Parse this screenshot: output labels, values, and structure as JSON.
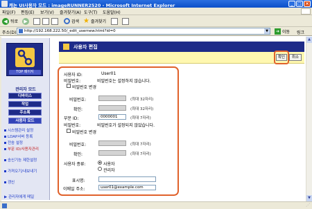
{
  "window": {
    "title": "캐논 UI사용자 모드 : imageRUNNER2520 - Microsoft Internet Explorer",
    "min": "_",
    "max": "□",
    "close": "×"
  },
  "menu": [
    "파일(F)",
    "편집(E)",
    "보기(V)",
    "즐겨찾기(A)",
    "도구(T)",
    "도움말(H)"
  ],
  "toolbar": {
    "back_label": "뒤로",
    "search_label": "검색",
    "favorites_label": "즐겨찾기"
  },
  "address": {
    "label": "주소(D)",
    "url": "http://192.168.222.50/_edit_usernew.html?id=0",
    "go_label": "이동",
    "links_label": "링크"
  },
  "sidebar": {
    "logo_caption": "TOP 페이지",
    "admin_mode_title": "관리자 모드",
    "nav": [
      "디바이스",
      "작업",
      "주소록",
      "사용자 모드"
    ],
    "links": [
      "시스템관리 설정",
      "LDAP서버 등록",
      "전송 설정",
      "부문 ID/사용자관리",
      "송신기능 제한설정",
      "가져오기/내보내기",
      "갱신"
    ],
    "management_link": "관리자에게 메일"
  },
  "panel": {
    "title": "사용자 편집",
    "ok_label": "확인",
    "cancel_label": "취소"
  },
  "form": {
    "user_id_label": "사용자 ID:",
    "user_id_value": "User01",
    "password_label": "비밀번호:",
    "password_status": "비밀번호는 설정하지 않습니다.",
    "change_password_label": "비밀번호 변경",
    "password_field_label": "비밀번호:",
    "password_hint": "(최대 32자리)",
    "confirm_label": "확인:",
    "confirm_hint": "(최대 32자리)",
    "dept_id_label": "부문 ID:",
    "dept_id_value": "0000001",
    "dept_id_hint": "(최대 7자리)",
    "dept_password_label": "비밀번호:",
    "dept_password_status": "비밀번호가 설정되지 않았습니다.",
    "change_dept_password_label": "비밀번호 변경",
    "dept_password_field_label": "비밀번호:",
    "dept_password_hint": "(최대 7자리)",
    "dept_confirm_label": "확인:",
    "dept_confirm_hint": "(최대 7자리)",
    "user_type_label": "사용자 종류:",
    "user_type_options": [
      "사용자",
      "관리자"
    ],
    "display_name_label": "표시명:",
    "display_name_value": "",
    "email_label": "이메일 주소:",
    "email_value": "user01@example.com"
  },
  "colors": {
    "header_navy": "#1e2b88",
    "action_bar_yellow": "#fff8b0",
    "highlight_orange": "#e0612a",
    "sidebar_bg": "#e3e6f3"
  }
}
